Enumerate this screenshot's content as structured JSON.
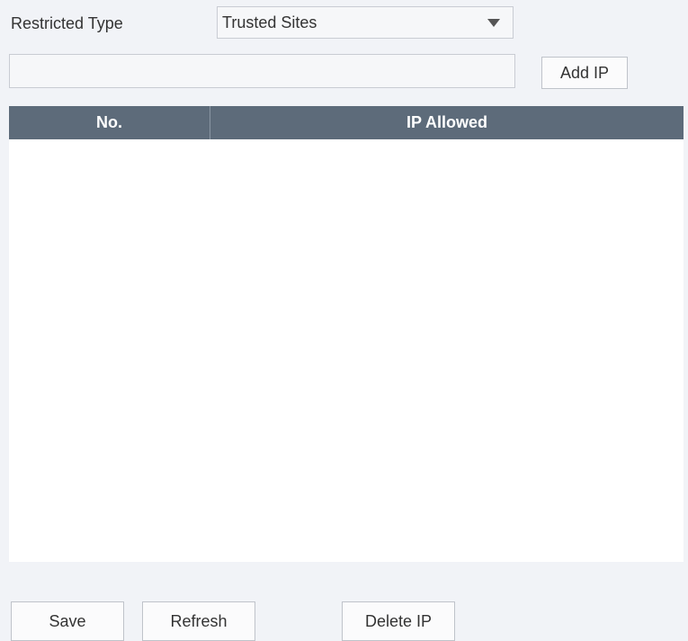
{
  "restricted_type": {
    "label": "Restricted Type",
    "selected_value": "Trusted Sites"
  },
  "ip_entry": {
    "value": "",
    "placeholder": "",
    "add_button_label": "Add IP"
  },
  "table": {
    "columns": [
      "No.",
      "IP Allowed"
    ],
    "rows": []
  },
  "actions": {
    "save_label": "Save",
    "refresh_label": "Refresh",
    "delete_label": "Delete IP"
  },
  "colors": {
    "header_background": "#5d6b7a",
    "page_background": "#f1f3f7"
  }
}
